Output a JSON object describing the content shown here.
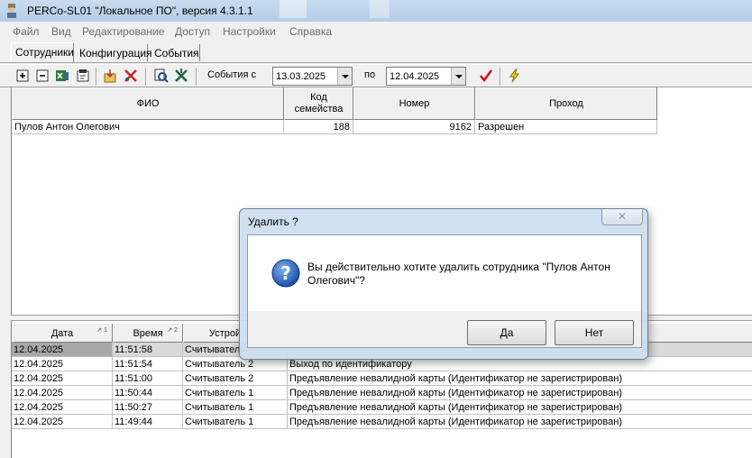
{
  "window": {
    "title": "PERCo-SL01 \"Локальное ПО\", версия 4.3.1.1",
    "icon": "perco-app-icon"
  },
  "menu": [
    "Файл",
    "Вид",
    "Редактирование",
    "Доступ",
    "Настройки",
    "Справка"
  ],
  "tabs": {
    "employees": "Сотрудники",
    "config": "Конфигурация",
    "events": "События",
    "active": "Сотрудники"
  },
  "toolbar": {
    "events_from_label": "События с",
    "date_from": "13.03.2025",
    "to_label": "по",
    "date_to": "12.04.2025",
    "icons": [
      "add-icon",
      "remove-icon",
      "excel-export-icon",
      "card-icon",
      "import-icon",
      "delete-tools-icon",
      "find-icon",
      "excel-icon",
      "apply-checkmark-icon",
      "lightning-icon"
    ]
  },
  "employees": {
    "columns": {
      "fio": "ФИО",
      "family_code_line1": "Код",
      "family_code_line2": "семейства",
      "number": "Номер",
      "pass": "Проход"
    },
    "rows": [
      {
        "fio": "Пулов Антон Олегович",
        "family_code": "188",
        "number": "9162",
        "pass": "Разрешен"
      }
    ]
  },
  "events": {
    "columns": {
      "date": "Дата",
      "date_sort": "↗ 1",
      "time": "Время",
      "time_sort": "↗ 2",
      "device": "Устрой"
    },
    "rows": [
      {
        "date": "12.04.2025",
        "time": "11:51:58",
        "device": "Считыватель",
        "event": ""
      },
      {
        "date": "12.04.2025",
        "time": "11:51:54",
        "device": "Считыватель 2",
        "event": "Выход по идентификатору"
      },
      {
        "date": "12.04.2025",
        "time": "11:51:00",
        "device": "Считыватель 2",
        "event": "Предъявление невалидной карты (Идентификатор не зарегистрирован)"
      },
      {
        "date": "12.04.2025",
        "time": "11:50:44",
        "device": "Считыватель 1",
        "event": "Предъявление невалидной карты (Идентификатор не зарегистрирован)"
      },
      {
        "date": "12.04.2025",
        "time": "11:50:27",
        "device": "Считыватель 1",
        "event": "Предъявление невалидной карты (Идентификатор не зарегистрирован)"
      },
      {
        "date": "12.04.2025",
        "time": "11:49:44",
        "device": "Считыватель 1",
        "event": "Предъявление невалидной карты (Идентификатор не зарегистрирован)"
      }
    ]
  },
  "dialog": {
    "title": "Удалить ?",
    "close_glyph": "✕",
    "message": "Вы действительно хотите удалить сотрудника \"Пулов Антон Олегович\"?",
    "yes": "Да",
    "no": "Нет",
    "icon": "question-icon"
  },
  "colors": {
    "titlebar": "#b9d1ea",
    "selected_row": "#d9d9d9",
    "dialog_frame": "#cddef0"
  }
}
